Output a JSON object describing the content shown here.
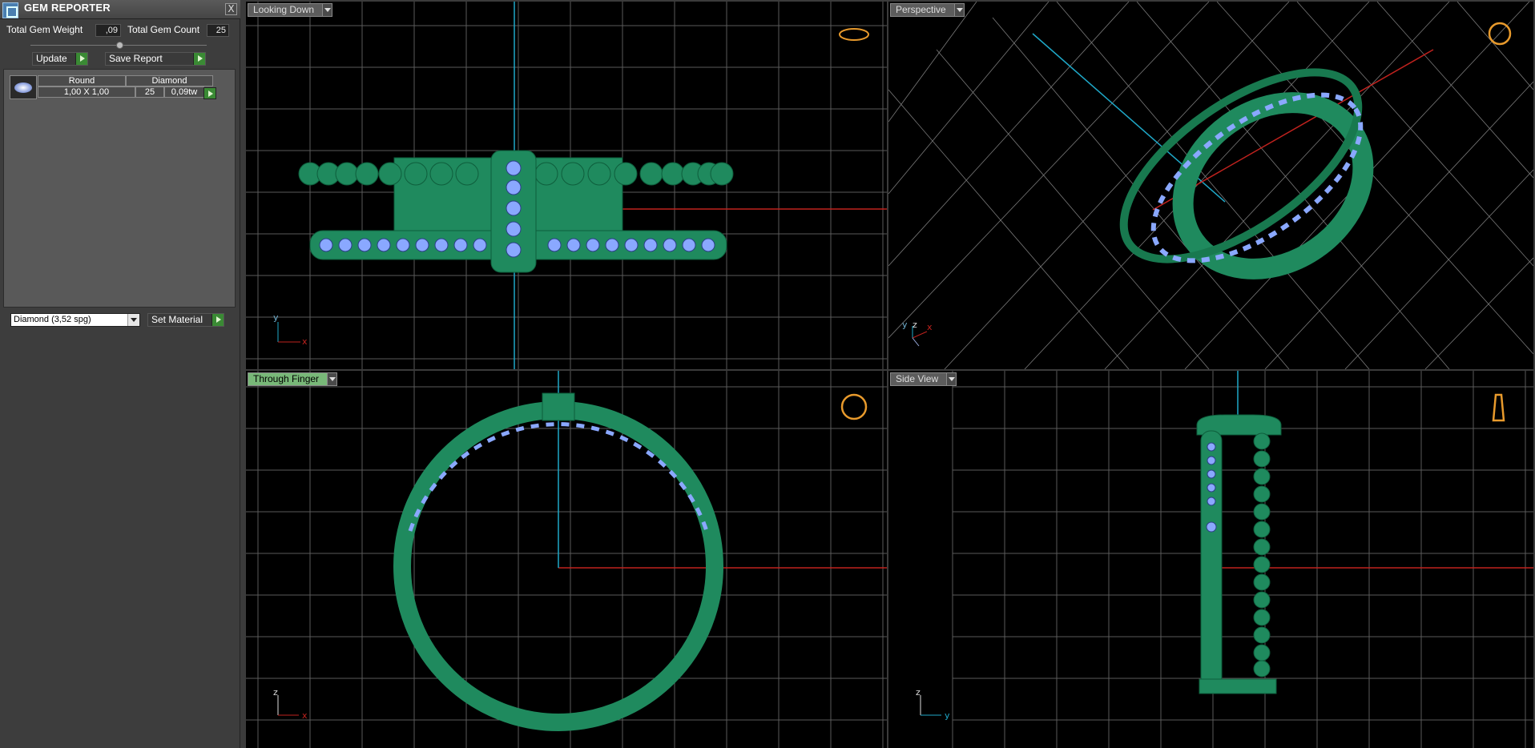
{
  "panel": {
    "title": "GEM REPORTER",
    "close_label": "X",
    "total_weight_label": "Total Gem Weight",
    "total_weight_value": ",09",
    "total_count_label": "Total Gem Count",
    "total_count_value": "25",
    "update_label": "Update",
    "save_report_label": "Save Report",
    "gems": {
      "shape": "Round",
      "material": "Diamond",
      "size": "1,00 X 1,00",
      "count": "25",
      "weight": "0,09tw"
    },
    "material_select": "Diamond    (3,52 spg)",
    "set_material_label": "Set Material"
  },
  "viewports": {
    "top_left": {
      "label": "Looking Down",
      "axis_a": "y",
      "axis_b": "x"
    },
    "top_right": {
      "label": "Perspective",
      "axis_a": "y",
      "axis_b": "z",
      "axis_c": "x"
    },
    "bottom_left": {
      "label": "Through Finger",
      "axis_a": "z",
      "axis_b": "x"
    },
    "bottom_right": {
      "label": "Side View",
      "axis_a": "z",
      "axis_b": "y"
    }
  },
  "colors": {
    "ring_green": "#1f8a5e",
    "gem_blue": "#8aa8ff",
    "grid": "#5a5a5a",
    "axis_red": "#c0221e",
    "axis_cyan": "#1fa8c8",
    "gizmo_orange": "#e89a2c"
  }
}
